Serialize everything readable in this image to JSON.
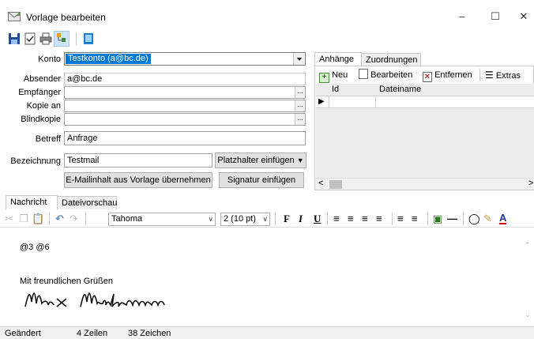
{
  "window": {
    "title": "Vorlage bearbeiten",
    "minimize": "–",
    "maximize": "☐",
    "close": "✕"
  },
  "toolbar": {
    "icons": [
      "save-icon",
      "checklist-icon",
      "print-icon",
      "tree-icon",
      "book-icon"
    ]
  },
  "form": {
    "konto_label": "Konto",
    "konto_value": "Testkonto (a@bc.de)",
    "absender_label": "Absender",
    "absender_value": "a@bc.de",
    "empfaenger_label": "Empfänger",
    "empfaenger_value": "",
    "kopie_label": "Kopie an",
    "kopie_value": "",
    "blindkopie_label": "Blindkopie",
    "blindkopie_value": "",
    "betreff_label": "Betreff",
    "betreff_value": "Anfrage",
    "bezeichnung_label": "Bezeichnung",
    "bezeichnung_value": "Testmail",
    "platzhalter_button": "Platzhalter einfügen",
    "uebernehmen_button": "E-Mailinhalt aus Vorlage übernehmen",
    "signatur_button": "Signatur einfügen",
    "dots": "..."
  },
  "right_panel": {
    "tabs": [
      "Anhänge",
      "Zuordnungen"
    ],
    "toolbar": {
      "neu": "Neu",
      "bearbeiten": "Bearbeiten",
      "entfernen": "Entfernen",
      "extras": "Extras"
    },
    "columns": [
      "Id",
      "Dateiname"
    ],
    "row_marker": "▶",
    "scroll_left": "<",
    "scroll_right": ">"
  },
  "editor_tabs": [
    "Nachricht",
    "Dateivorschau"
  ],
  "editor_toolbar": {
    "font": "Tahoma",
    "size": "2 (10 pt)",
    "bold": "F",
    "italic": "I",
    "underline": "U"
  },
  "editor": {
    "line1": "@3 @6",
    "greeting": "Mit freundlichen Grüßen",
    "signature_image": "Max Mustermann"
  },
  "status": {
    "state": "Geändert",
    "lines": "4 Zeilen",
    "chars": "38 Zeichen"
  },
  "colors": {
    "selection": "#0078d7",
    "accent_red": "#c00000",
    "underline_red": "#d00000"
  }
}
